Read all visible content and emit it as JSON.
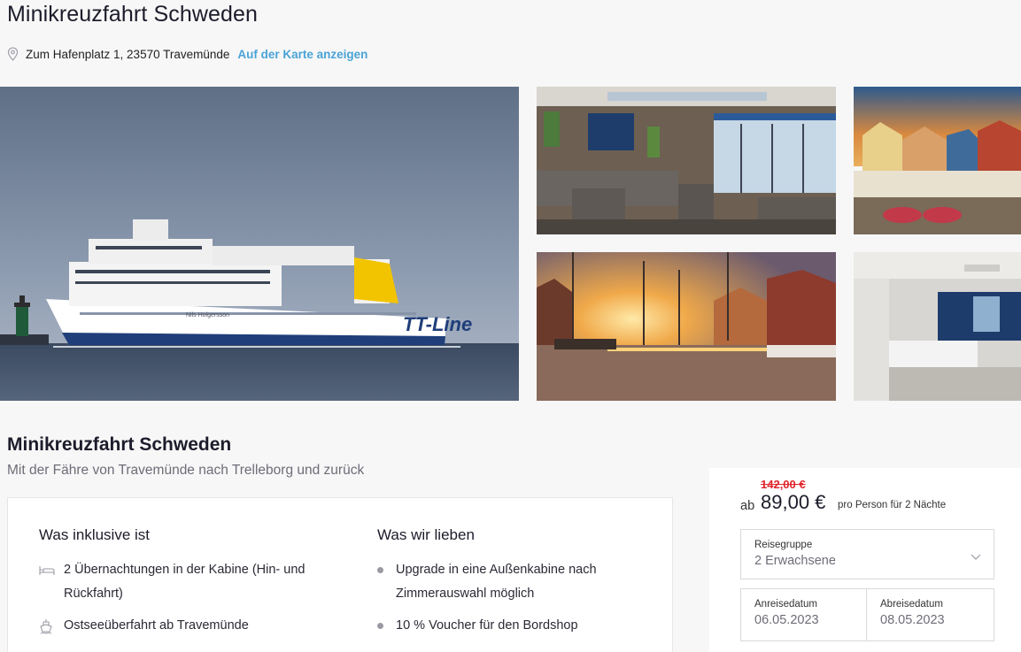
{
  "page": {
    "title": "Minikreuzfahrt Schweden",
    "address": "Zum Hafenplatz 1, 23570 Travemünde",
    "map_link": "Auf der Karte anzeigen"
  },
  "gallery": {
    "images": [
      "ferry-photo",
      "lounge-photo",
      "old-town-photo",
      "harbor-sunset-photo",
      "cabin-photo"
    ],
    "ship_lettering": "TT-Line",
    "ship_name": "Nils Holgersson"
  },
  "offer": {
    "heading": "Minikreuzfahrt Schweden",
    "subtitle": "Mit der Fähre von Travemünde nach Trelleborg und zurück"
  },
  "inclusive": {
    "heading": "Was inklusive ist",
    "items": [
      {
        "icon": "bed-icon",
        "text": "2 Übernachtungen in der Kabine (Hin- und Rückfahrt)"
      },
      {
        "icon": "ship-icon",
        "text": "Ostseeüberfahrt ab Travemünde"
      }
    ]
  },
  "love": {
    "heading": "Was wir lieben",
    "items": [
      {
        "text": "Upgrade in eine Außenkabine nach Zimmerauswahl möglich"
      },
      {
        "text": "10 % Voucher für den Bordshop"
      }
    ]
  },
  "booking": {
    "old_price": "142,00 €",
    "prefix": "ab",
    "price": "89,00 €",
    "per_note": "pro Person für 2 Nächte",
    "group_label": "Reisegruppe",
    "group_value": "2 Erwachsene",
    "arrival_label": "Anreisedatum",
    "arrival_value": "06.05.2023",
    "departure_label": "Abreisedatum",
    "departure_value": "08.05.2023"
  },
  "colors": {
    "accent_link": "#4aa3d6",
    "strike_price": "#e0242b",
    "ship_logo_yellow": "#f2c400"
  }
}
